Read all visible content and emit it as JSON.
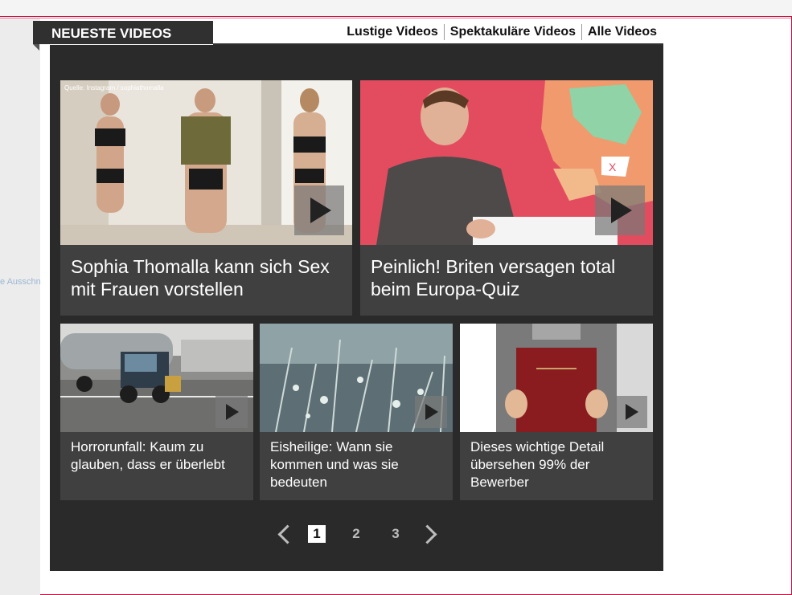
{
  "left_gutter_text": "e Ausschn",
  "header": {
    "section_title": "NEUESTE VIDEOS",
    "nav": [
      "Lustige Videos",
      "Spektakuläre Videos",
      "Alle Videos"
    ]
  },
  "videos_featured": [
    {
      "title": "Sophia Thomalla kann sich Sex mit Frauen vorstellen",
      "thumb_caption": "Quelle: Instagram / sophiathomalla"
    },
    {
      "title": "Peinlich! Briten versagen total beim Europa-Quiz"
    }
  ],
  "videos_small": [
    {
      "title": "Horrorunfall: Kaum zu glauben, dass er überlebt"
    },
    {
      "title": "Eisheilige: Wann sie kommen und was sie bedeuten"
    },
    {
      "title": "Dieses wichtige Detail übersehen 99% der Bewerber"
    }
  ],
  "pagination": {
    "pages": [
      "1",
      "2",
      "3"
    ],
    "current": "1"
  }
}
